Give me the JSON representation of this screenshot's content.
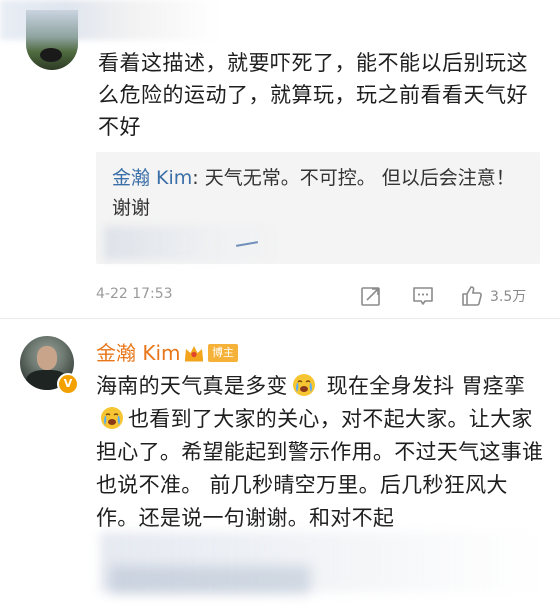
{
  "comment1": {
    "text": "看着这描述，就要吓死了，能不能以后别玩这么危险的运动了，就算玩，玩之前看看天气好不好",
    "reply": {
      "author": "金瀚 Kim",
      "text": "天气无常。不可控。 但以后会注意！谢谢"
    },
    "time": "4-22 17:53",
    "like_count": "3.5万"
  },
  "comment2": {
    "author": "金瀚 Kim",
    "badge": "博主",
    "verified_mark": "V",
    "text_part1": "海南的天气真是多变",
    "text_part2": " 现在全身发抖 胃痉挛",
    "text_part3": "也看到了大家的关心，对不起大家。让大家担心了。希望能起到警示作用。不过天气这事谁也说不准。 前几秒晴空万里。后几秒狂风大作。还是说一句谢谢。和对不起"
  },
  "colors": {
    "author": "#e8761a",
    "reply_author": "#3b6fa8",
    "badge": "#f6b238",
    "meta": "#9a9a9a"
  },
  "icons": [
    "share-icon",
    "comment-icon",
    "like-icon",
    "crown-icon",
    "crying-emoji-icon"
  ]
}
